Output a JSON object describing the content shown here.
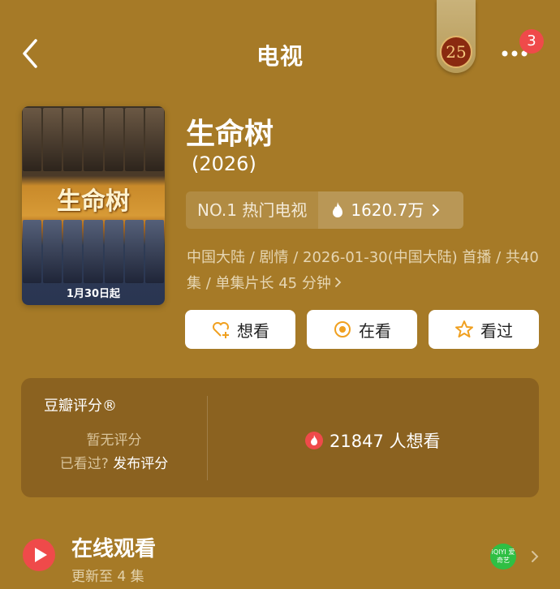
{
  "header": {
    "title": "电视",
    "badge_number": "25",
    "notification_count": "3"
  },
  "poster": {
    "title": "生命树",
    "date": "1月30日起"
  },
  "show": {
    "title": "生命树",
    "year": "(2026)",
    "rank_label": "NO.1 热门电视",
    "heat": "1620.7万",
    "meta": "中国大陆 / 剧情 / 2026-01-30(中国大陆) 首播 / 共40集 / 单集片长 45 分钟"
  },
  "actions": [
    {
      "label": "想看",
      "icon": "heart-plus-icon"
    },
    {
      "label": "在看",
      "icon": "watching-icon"
    },
    {
      "label": "看过",
      "icon": "star-icon"
    }
  ],
  "rating": {
    "title": "豆瓣评分®",
    "no_rating": "暂无评分",
    "seen_question": "已看过?",
    "post_rating": "发布评分",
    "wish_count": "21847 人想看"
  },
  "watch": {
    "title": "在线观看",
    "subtitle": "更新至 4 集",
    "provider_icon": "iqiyi-icon",
    "provider_text": "iQIYI 爱奇艺"
  },
  "colors": {
    "background": "#A67A27",
    "card": "#8B6220",
    "accent_red": "#EF4A4A",
    "action_orange": "#F0A020"
  }
}
